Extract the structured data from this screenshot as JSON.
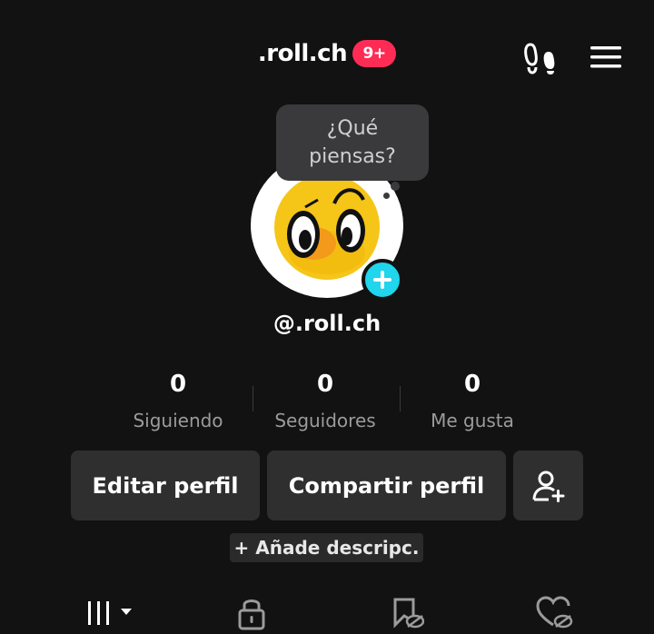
{
  "header": {
    "title": ".roll.ch",
    "notification_badge": "9+",
    "footprints_icon": "footprints-icon",
    "menu_icon": "hamburger-menu-icon"
  },
  "avatar": {
    "bubble_line1": "¿Qué",
    "bubble_line2": "piensas?",
    "add_icon": "plus-icon"
  },
  "profile": {
    "username": "@.roll.ch"
  },
  "stats": [
    {
      "value": "0",
      "label": "Siguiendo"
    },
    {
      "value": "0",
      "label": "Seguidores"
    },
    {
      "value": "0",
      "label": "Me gusta"
    }
  ],
  "actions": {
    "edit_profile": "Editar perfil",
    "share_profile": "Compartir perfil",
    "add_friend_icon": "add-user-icon"
  },
  "description_button": "+ Añade descripc.",
  "tabs": [
    {
      "icon": "grid-icon"
    },
    {
      "icon": "lock-icon"
    },
    {
      "icon": "bookmark-hidden-icon"
    },
    {
      "icon": "heart-hidden-icon"
    }
  ],
  "colors": {
    "background": "#121212",
    "badge": "#fe2c55",
    "add_button": "#20d5ec",
    "button_bg": "#2f2f2f"
  }
}
